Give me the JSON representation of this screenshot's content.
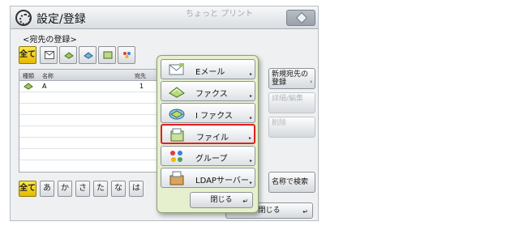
{
  "titlebar": {
    "title": "設定/登録",
    "quickprint": "ちょっと プリント"
  },
  "subtitle": "<宛先の登録>",
  "filter": {
    "all": "全て"
  },
  "list": {
    "headers": [
      "種類",
      "名称",
      "宛先"
    ],
    "rows": [
      {
        "name": "A",
        "number": "1"
      }
    ],
    "partial_text": "1"
  },
  "kana": [
    "全て",
    "あ",
    "か",
    "さ",
    "た",
    "な",
    "は"
  ],
  "side_buttons": {
    "new_dest": "新規宛先の登録",
    "detail_edit": "詳細/編集",
    "delete": "削除",
    "search_name": "名称で検索"
  },
  "back_close": "閉じる",
  "popup": {
    "items": [
      {
        "label": "Eメール",
        "icon": "email-icon"
      },
      {
        "label": "ファクス",
        "icon": "fax-icon"
      },
      {
        "label": "I ファクス",
        "icon": "ifax-icon"
      },
      {
        "label": "ファイル",
        "icon": "file-icon"
      },
      {
        "label": "グループ",
        "icon": "group-icon"
      },
      {
        "label": "LDAPサーバー",
        "icon": "ldap-icon"
      }
    ],
    "selected_index": 3,
    "close": "閉じる"
  },
  "colors": {
    "accent_yellow": "#f2cc00",
    "popup_bg": "#e6f0cf",
    "selection_red": "#e02020"
  }
}
